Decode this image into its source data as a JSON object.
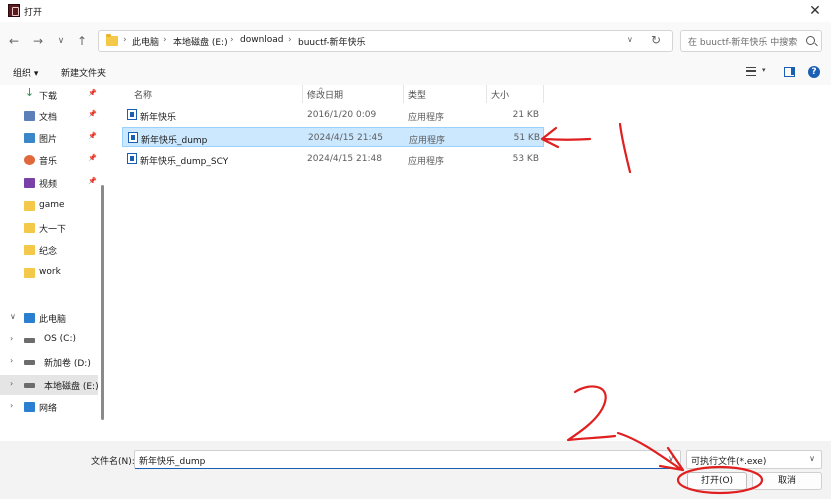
{
  "window": {
    "title": "打开",
    "close_glyph": "✕"
  },
  "nav": {
    "back_glyph": "←",
    "forward_glyph": "→",
    "recent_glyph": "∨",
    "up_glyph": "↑"
  },
  "address": {
    "crumbs": [
      "此电脑",
      "本地磁盘 (E:)",
      "download",
      "buuctf-新年快乐"
    ],
    "separator": "›",
    "dropdown_glyph": "∨",
    "refresh_glyph": "↻"
  },
  "search": {
    "placeholder": "在 buuctf-新年快乐 中搜索"
  },
  "toolbar": {
    "organize": "组织 ▾",
    "new_folder": "新建文件夹",
    "view_dropdown_glyph": "▾",
    "help_glyph": "?"
  },
  "sidebar": {
    "pin_glyph": "📌",
    "items": [
      {
        "label": "下载",
        "icon": "download-icon",
        "pinned": true
      },
      {
        "label": "文档",
        "icon": "document-icon",
        "pinned": true
      },
      {
        "label": "图片",
        "icon": "pictures-icon",
        "pinned": true
      },
      {
        "label": "音乐",
        "icon": "music-icon",
        "pinned": true
      },
      {
        "label": "视频",
        "icon": "video-icon",
        "pinned": true
      },
      {
        "label": "game",
        "icon": "folder-icon"
      },
      {
        "label": "大一下",
        "icon": "folder-icon"
      },
      {
        "label": "纪念",
        "icon": "folder-icon"
      },
      {
        "label": "work",
        "icon": "folder-icon"
      },
      {
        "label": "此电脑",
        "icon": "computer-icon",
        "chevron": "∨"
      },
      {
        "label": "OS (C:)",
        "icon": "drive-icon",
        "chevron": "›"
      },
      {
        "label": "新加卷 (D:)",
        "icon": "drive-icon",
        "chevron": "›"
      },
      {
        "label": "本地磁盘 (E:)",
        "icon": "drive-icon",
        "chevron": "›",
        "selected": true
      },
      {
        "label": "网络",
        "icon": "network-icon",
        "chevron": "›"
      }
    ]
  },
  "columns": {
    "name": "名称",
    "modified": "修改日期",
    "type": "类型",
    "size": "大小",
    "sort_glyph": "^"
  },
  "files": [
    {
      "name": "新年快乐",
      "modified": "2016/1/20 0:09",
      "type": "应用程序",
      "size": "21 KB",
      "selected": false
    },
    {
      "name": "新年快乐_dump",
      "modified": "2024/4/15 21:45",
      "type": "应用程序",
      "size": "51 KB",
      "selected": true
    },
    {
      "name": "新年快乐_dump_SCY",
      "modified": "2024/4/15 21:48",
      "type": "应用程序",
      "size": "53 KB",
      "selected": false
    }
  ],
  "footer": {
    "filename_label": "文件名(N):",
    "filename_value": "新年快乐_dump",
    "filetype_value": "可执行文件(*.exe)",
    "dropdown_glyph": "∨",
    "open_button": "打开(O)",
    "cancel_button": "取消"
  },
  "colors": {
    "accent": "#1a5fb4",
    "selection": "#cce8ff",
    "annotation": "#e02020"
  }
}
